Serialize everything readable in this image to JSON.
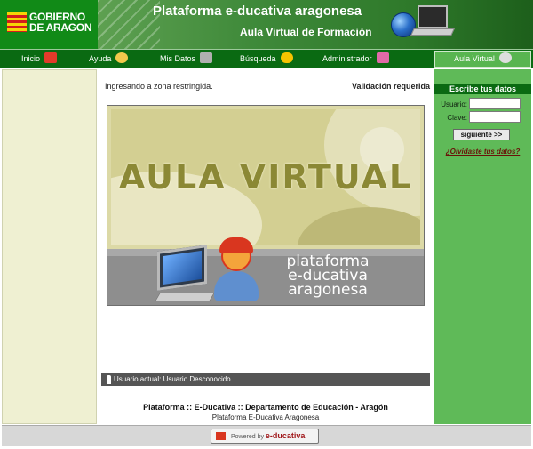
{
  "header": {
    "logo_text": "GOBIERNO\nDE ARAGON",
    "title": "Plataforma e-ducativa aragonesa",
    "subtitle": "Aula Virtual de Formación"
  },
  "nav": {
    "inicio": "Inicio",
    "ayuda": "Ayuda",
    "mis_datos": "Mis Datos",
    "busqueda": "Búsqueda",
    "administrador": "Administrador",
    "aula_virtual": "Aula Virtual"
  },
  "main": {
    "status_left": "Ingresando a zona restringida.",
    "status_right": "Validación requerida",
    "banner_title": "AULA VIRTUAL",
    "banner_sub_1": "plataforma",
    "banner_sub_2": "e-ducativa",
    "banner_sub_3": "aragonesa",
    "user_bar": "Usuario actual: Usuario Desconocido",
    "footer_main": "Plataforma :: E-Ducativa :: Departamento de Educación - Aragón",
    "footer_sub": "Plataforma E-Ducativa Aragonesa"
  },
  "login": {
    "heading": "Escribe tus datos",
    "usuario_label": "Usuario:",
    "clave_label": "Clave:",
    "usuario_value": "",
    "clave_value": "",
    "submit_label": "siguiente >>",
    "forgot_link": "¿Olvidaste tus datos?"
  },
  "bottom": {
    "powered_prefix": "Powered by",
    "powered_brand": "e-ducativa"
  }
}
